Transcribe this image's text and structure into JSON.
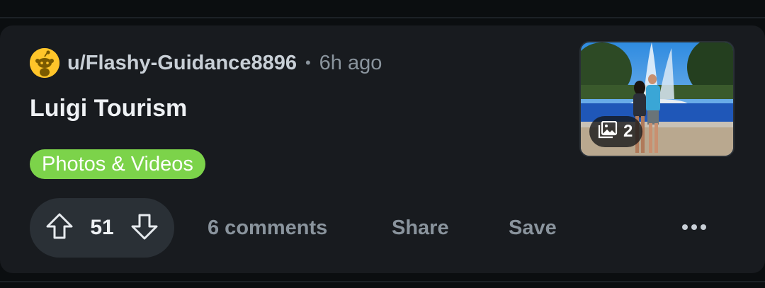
{
  "post": {
    "username": "u/Flashy-Guidance8896",
    "separator": "•",
    "time_ago": "6h ago",
    "title": "Luigi Tourism",
    "flair": "Photos & Videos",
    "gallery_count": "2",
    "vote_count": "51",
    "comments_label": "6 comments",
    "share_label": "Share",
    "save_label": "Save"
  },
  "icons": {
    "avatar": "reddit-snoo-icon",
    "upvote": "upvote-arrow-icon",
    "downvote": "downvote-arrow-icon",
    "gallery": "gallery-icon",
    "more": "more-options-icon"
  },
  "colors": {
    "background": "#0b0e10",
    "card": "#181b1f",
    "flair": "#7cd34a",
    "avatar": "#ffc52a",
    "vote_pill": "#2a3036",
    "muted_text": "#8a949d"
  }
}
